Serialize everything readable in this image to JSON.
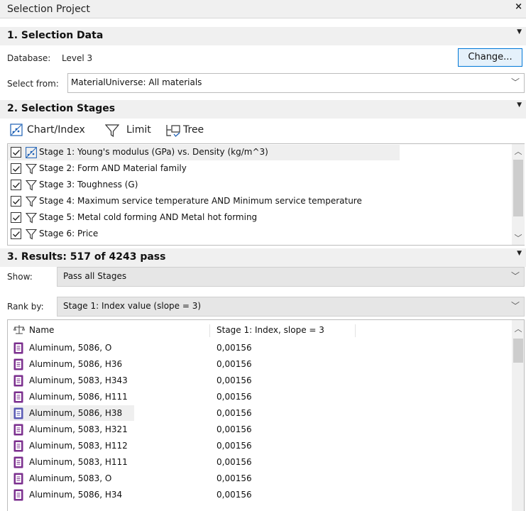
{
  "window": {
    "title": "Selection Project",
    "close": "×"
  },
  "section1": {
    "title": "1. Selection Data",
    "database_label": "Database:",
    "database_value": "Level 3",
    "change_button": "Change...",
    "select_from_label": "Select from:",
    "select_from_value": "MaterialUniverse: All materials"
  },
  "section2": {
    "title": "2. Selection Stages",
    "toolbar": {
      "chart_index": "Chart/Index",
      "limit": "Limit",
      "tree": "Tree"
    },
    "stages": [
      {
        "label": "Stage 1: Young's modulus (GPa) vs. Density (kg/m^3)",
        "checked": true,
        "icon": "chart-index-icon"
      },
      {
        "label": "Stage 2: Form AND Material family",
        "checked": true,
        "icon": "filter-icon"
      },
      {
        "label": "Stage 3: Toughness (G)",
        "checked": true,
        "icon": "filter-icon"
      },
      {
        "label": "Stage 4: Maximum service temperature AND Minimum service temperature",
        "checked": true,
        "icon": "filter-icon"
      },
      {
        "label": "Stage 5: Metal cold forming AND Metal hot forming",
        "checked": true,
        "icon": "filter-icon"
      },
      {
        "label": "Stage 6: Price",
        "checked": true,
        "icon": "filter-icon"
      }
    ]
  },
  "section3": {
    "title": "3. Results: 517 of 4243 pass",
    "show_label": "Show:",
    "show_value": "Pass all Stages",
    "rank_label": "Rank by:",
    "rank_value": "Stage 1: Index value (slope = 3)",
    "columns": [
      "Name",
      "Stage 1: Index, slope = 3"
    ],
    "rows": [
      {
        "name": "Aluminum, 5086, O",
        "value": "0,00156"
      },
      {
        "name": "Aluminum, 5086, H36",
        "value": "0,00156"
      },
      {
        "name": "Aluminum, 5083, H343",
        "value": "0,00156"
      },
      {
        "name": "Aluminum, 5086, H111",
        "value": "0,00156"
      },
      {
        "name": "Aluminum, 5086, H38",
        "value": "0,00156"
      },
      {
        "name": "Aluminum, 5083, H321",
        "value": "0,00156"
      },
      {
        "name": "Aluminum, 5083, H112",
        "value": "0,00156"
      },
      {
        "name": "Aluminum, 5083, H111",
        "value": "0,00156"
      },
      {
        "name": "Aluminum, 5083, O",
        "value": "0,00156"
      },
      {
        "name": "Aluminum, 5086, H34",
        "value": "0,00156"
      }
    ]
  },
  "colors": {
    "accent": "#0078d7",
    "record_icon": "#7b2f8e",
    "record_icon_selected": "#5a5ab4"
  }
}
